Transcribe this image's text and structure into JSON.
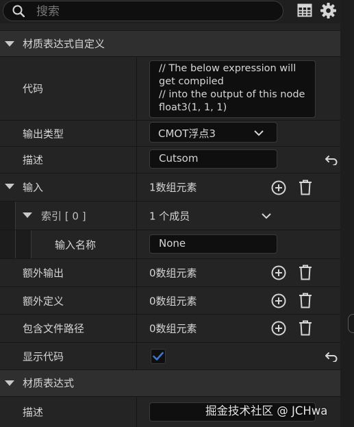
{
  "search": {
    "placeholder": "搜索"
  },
  "section_custom": {
    "title": "材质表达式自定义",
    "code": {
      "label": "代码",
      "lines": [
        "// The below expression will",
        "get compiled",
        "// into the output of this node",
        "float3(1, 1, 1)"
      ]
    },
    "output_type": {
      "label": "输出类型",
      "value": "CMOT浮点3"
    },
    "description": {
      "label": "描述",
      "value": "Cutsom"
    },
    "inputs": {
      "label": "输入",
      "value": "1数组元素",
      "index": {
        "label": "索引 [ 0 ]",
        "value": "1 个成员",
        "input_name": {
          "label": "输入名称",
          "value": "None"
        }
      }
    },
    "additional_outputs": {
      "label": "额外输出",
      "value": "0数组元素"
    },
    "additional_defines": {
      "label": "额外定义",
      "value": "0数组元素"
    },
    "include_file_paths": {
      "label": "包含文件路径",
      "value": "0数组元素"
    },
    "show_code": {
      "label": "显示代码",
      "checked": true
    }
  },
  "section_expression": {
    "title": "材质表达式",
    "description": {
      "label": "描述",
      "value": ""
    }
  },
  "watermark": "掘金技术社区 @ JCHwa",
  "colors": {
    "checkbox": "#3b78d0",
    "background": "#242424",
    "header": "#2f2f2f"
  }
}
